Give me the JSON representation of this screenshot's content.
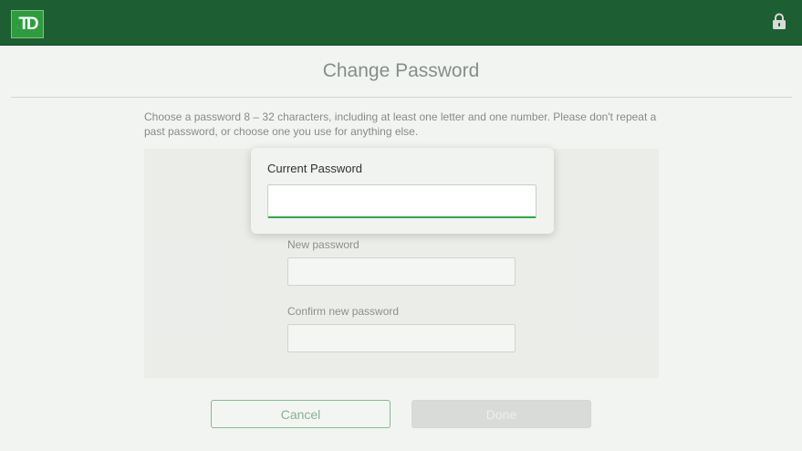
{
  "header": {
    "logo_text": "TD",
    "brand_color": "#1d5e32",
    "lock_icon": "lock-icon"
  },
  "main": {
    "title": "Change Password",
    "instructions": "Choose a password 8 – 32 characters, including at least one letter and one number. Please don't repeat a past password, or choose one you use for anything else.",
    "fields": {
      "new_password_label": "New password",
      "new_password_value": "",
      "confirm_password_label": "Confirm new password",
      "confirm_password_value": ""
    },
    "buttons": {
      "cancel_label": "Cancel",
      "done_label": "Done"
    }
  },
  "popup": {
    "label": "Current Password",
    "value": "",
    "accent_color": "#2fa84a"
  }
}
